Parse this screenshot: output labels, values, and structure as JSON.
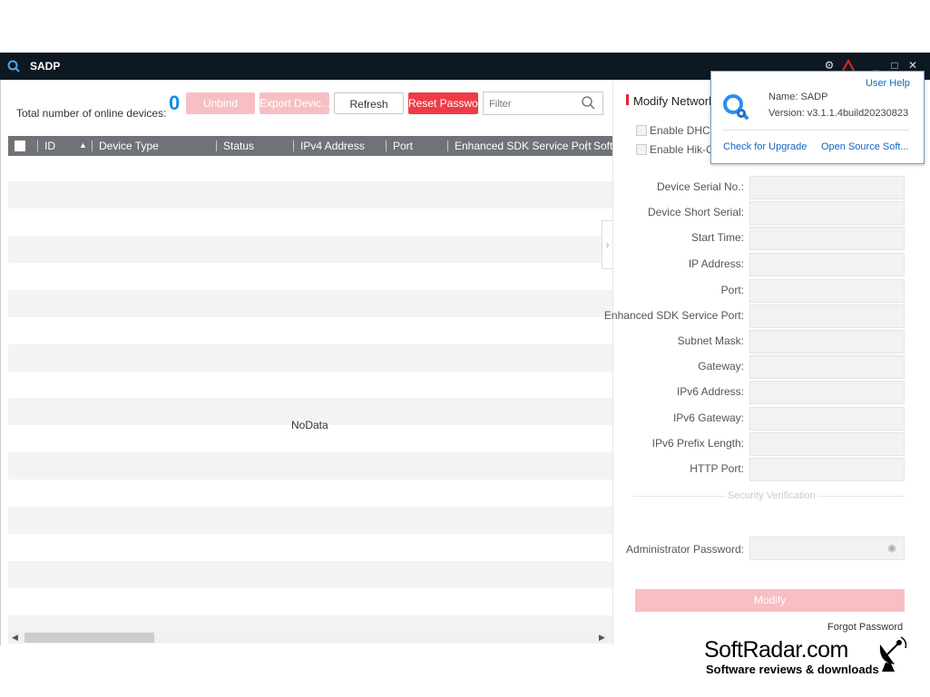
{
  "app": {
    "title": "SADP"
  },
  "device_list": {
    "total_label": "Total number of online devices:",
    "total_count": "0",
    "buttons": {
      "unbind": "Unbind",
      "export": "Export Devic...",
      "refresh": "Refresh",
      "reset_password": "Reset Passwo..."
    },
    "filter_placeholder": "Filter",
    "columns": [
      "ID",
      "Device Type",
      "Status",
      "IPv4 Address",
      "Port",
      "Enhanced SDK Service Port",
      "Soft"
    ],
    "empty_text": "NoData"
  },
  "modify_panel": {
    "title": "Modify Network",
    "checkboxes": [
      "Enable DHCP",
      "Enable Hik-Co"
    ],
    "fields": [
      "Device Serial No.:",
      "Device Short Serial:",
      "Start Time:",
      "IP Address:",
      "Port:",
      "Enhanced SDK Service Port:",
      "Subnet Mask:",
      "Gateway:",
      "IPv6 Address:",
      "IPv6 Gateway:",
      "IPv6 Prefix Length:",
      "HTTP Port:"
    ],
    "security_label": "Security Verification",
    "admin_password_label": "Administrator Password:",
    "modify_button": "Modify",
    "forgot_password": "Forgot Password"
  },
  "about_popup": {
    "user_help": "User Help",
    "name": "Name: SADP",
    "version": "Version: v3.1.1.4build20230823",
    "check_upgrade": "Check for Upgrade",
    "open_source": "Open Source Soft..."
  },
  "watermark": {
    "brand": "SoftRadar.com",
    "tagline": "Software reviews & downloads"
  },
  "colors": {
    "titlebar": "#0e1821",
    "accent_red": "#ef3b47",
    "count_blue": "#0e8de6",
    "link_blue": "#1366c2"
  }
}
